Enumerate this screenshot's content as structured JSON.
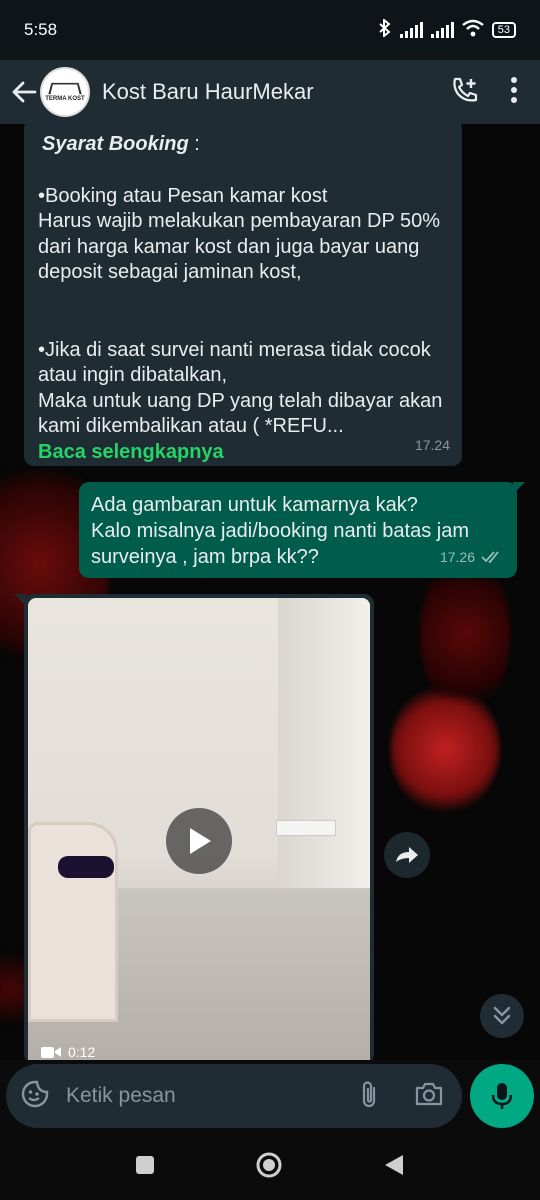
{
  "status_bar": {
    "time": "5:58",
    "battery": "53"
  },
  "app_bar": {
    "title": "Kost Baru HaurMekar",
    "avatar_text": "TERMA KOST"
  },
  "messages": {
    "incoming_text": {
      "heading": "Syarat Booking",
      "heading_suffix": " :",
      "paragraph1": "•Booking atau Pesan kamar kost\nHarus wajib melakukan pembayaran DP 50% dari harga kamar kost dan juga bayar uang deposit sebagai jaminan kost,",
      "paragraph2": "•Jika di saat survei nanti merasa tidak cocok atau ingin dibatalkan,\nMaka untuk uang DP yang telah dibayar akan kami dikembalikan atau ( *REFU...",
      "read_more": "Baca selengkapnya",
      "time": "17.24"
    },
    "outgoing_text": {
      "text": "Ada gambaran untuk kamarnya kak?\nKalo misalnya jadi/booking nanti batas jam surveinya , jam brpa kk??",
      "time": "17.26"
    },
    "incoming_video": {
      "duration": "0:12"
    }
  },
  "input": {
    "placeholder": "Ketik pesan"
  },
  "colors": {
    "incoming_bubble": "#1f2c33",
    "outgoing_bubble": "#005c4b",
    "accent_green": "#25d366",
    "mic_green": "#00a884"
  }
}
